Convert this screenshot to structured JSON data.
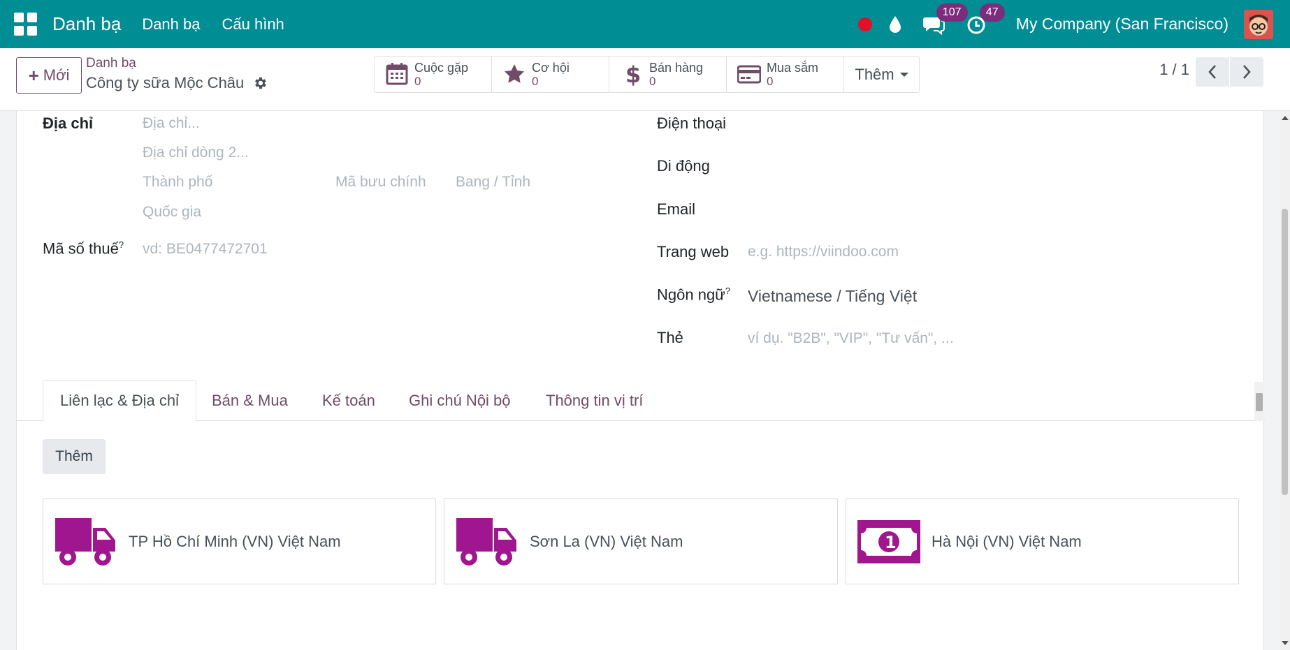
{
  "navbar": {
    "brand": "Danh bạ",
    "menu": [
      "Danh bạ",
      "Cấu hình"
    ],
    "messages_count": "107",
    "activities_count": "47",
    "company": "My Company (San Francisco)",
    "color": "#018d94"
  },
  "control_panel": {
    "new_button": "Mới",
    "breadcrumb_parent": "Danh bạ",
    "breadcrumb_current": "Công ty sữa Mộc Châu",
    "smart_buttons": [
      {
        "label": "Cuộc gặp",
        "value": "0",
        "icon": "calendar-icon"
      },
      {
        "label": "Cơ hội",
        "value": "0",
        "icon": "star-icon"
      },
      {
        "label": "Bán hàng",
        "value": "0",
        "icon": "dollar-icon"
      },
      {
        "label": "Mua sắm",
        "value": "0",
        "icon": "credit-card-icon"
      }
    ],
    "more_button": "Thêm",
    "pager": "1 / 1"
  },
  "form": {
    "address_label": "Địa chỉ",
    "street_placeholder": "Địa chỉ...",
    "street2_placeholder": "Địa chỉ dòng 2...",
    "city_placeholder": "Thành phố",
    "zip_placeholder": "Mã bưu chính",
    "state_placeholder": "Bang / Tỉnh",
    "country_placeholder": "Quốc gia",
    "vat_label": "Mã số thuế",
    "vat_placeholder": "vd: BE0477472701",
    "phone_label": "Điện thoại",
    "mobile_label": "Di động",
    "email_label": "Email",
    "website_label": "Trang web",
    "website_placeholder": "e.g. https://viindoo.com",
    "language_label": "Ngôn ngữ",
    "language_value": "Vietnamese / Tiếng Việt",
    "tags_label": "Thẻ",
    "tags_placeholder": "ví dụ. \"B2B\", \"VIP\", \"Tư vấn\", ...",
    "help_mark": "?"
  },
  "tabs": [
    "Liên lạc & Địa chỉ",
    "Bán & Mua",
    "Kế toán",
    "Ghi chú Nội bộ",
    "Thông tin vị trí"
  ],
  "contacts": {
    "add_button": "Thêm",
    "cards": [
      {
        "text": "TP Hồ Chí Minh (VN) Việt Nam",
        "icon": "truck-icon"
      },
      {
        "text": "Sơn La (VN) Việt Nam",
        "icon": "truck-icon"
      },
      {
        "text": "Hà Nội (VN) Việt Nam",
        "icon": "money-bill-icon"
      }
    ],
    "accent_color": "#a0168e"
  }
}
